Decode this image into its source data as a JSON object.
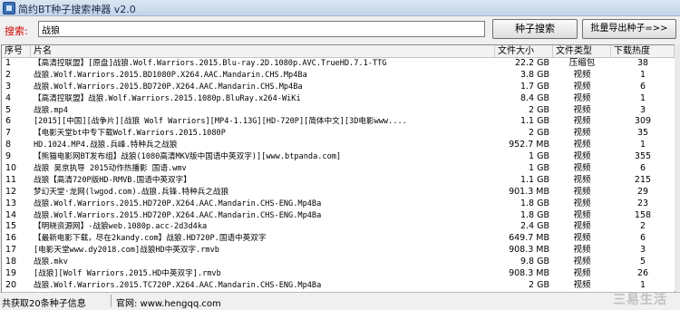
{
  "window": {
    "title": "简约BT种子搜索神器 v2.0"
  },
  "toolbar": {
    "search_label": "搜索:",
    "search_value": "战狼",
    "search_button": "种子搜索",
    "export_button": "批量导出种子=>>"
  },
  "grid": {
    "columns": [
      "序号",
      "片名",
      "文件大小",
      "文件类型",
      "下载热度"
    ],
    "rows": [
      {
        "idx": "1",
        "name": "【高清控联盟】[原盘]战狼.Wolf.Warriors.2015.Blu-ray.2D.1080p.AVC.TrueHD.7.1-TTG",
        "size": "22.2 GB",
        "type": "压缩包",
        "heat": "38"
      },
      {
        "idx": "2",
        "name": "战狼.Wolf.Warriors.2015.BD1080P.X264.AAC.Mandarin.CHS.Mp4Ba",
        "size": "3.8 GB",
        "type": "视频",
        "heat": "1"
      },
      {
        "idx": "3",
        "name": "战狼.Wolf.Warriors.2015.BD720P.X264.AAC.Mandarin.CHS.Mp4Ba",
        "size": "1.7 GB",
        "type": "视频",
        "heat": "6"
      },
      {
        "idx": "4",
        "name": "【高清控联盟】战狼.Wolf.Warriors.2015.1080p.BluRay.x264-WiKi",
        "size": "8.4 GB",
        "type": "视频",
        "heat": "1"
      },
      {
        "idx": "5",
        "name": "战狼.mp4",
        "size": "2 GB",
        "type": "视频",
        "heat": "3"
      },
      {
        "idx": "6",
        "name": "[2015][中国][战争片][战狼 Wolf Warriors][MP4-1.13G][HD-720P][简体中文][3D电影www....",
        "size": "1.1 GB",
        "type": "视频",
        "heat": "309"
      },
      {
        "idx": "7",
        "name": "【电影天堂bt中专下载Wolf.Warriors.2015.1080P",
        "size": "2 GB",
        "type": "视频",
        "heat": "35"
      },
      {
        "idx": "8",
        "name": "HD.1024.MP4.战狼.兵峰.特种兵之战狼",
        "size": "952.7 MB",
        "type": "视频",
        "heat": "1"
      },
      {
        "idx": "9",
        "name": "【熊猫电影网BT发布组】战狼(1080高清MKV版中国语中英双字)][www.btpanda.com]",
        "size": "1 GB",
        "type": "视频",
        "heat": "355"
      },
      {
        "idx": "10",
        "name": "战狼 吴京执导 2015动作热播影 国语.wmv",
        "size": "1 GB",
        "type": "视频",
        "heat": "6"
      },
      {
        "idx": "11",
        "name": "战狼【高清720P版HD-RMVB.国语中英双字】",
        "size": "1.1 GB",
        "type": "视频",
        "heat": "215"
      },
      {
        "idx": "12",
        "name": "梦幻天堂·龙网(lwgod.com).战狼.兵锋.特种兵之战狼",
        "size": "901.3 MB",
        "type": "视频",
        "heat": "29"
      },
      {
        "idx": "13",
        "name": "战狼.Wolf.Warriors.2015.HD720P.X264.AAC.Mandarin.CHS-ENG.Mp4Ba",
        "size": "1.8 GB",
        "type": "视频",
        "heat": "23"
      },
      {
        "idx": "14",
        "name": "战狼.Wolf.Warriors.2015.HD720P.X264.AAC.Mandarin.CHS-ENG.Mp4Ba",
        "size": "1.8 GB",
        "type": "视频",
        "heat": "158"
      },
      {
        "idx": "15",
        "name": "【明晓资源网】-战狼web.1080p.acc-2d3d4ka",
        "size": "2.4 GB",
        "type": "视频",
        "heat": "2"
      },
      {
        "idx": "16",
        "name": "【最新电影下载，尽在2kandy.com】战狼.HD720P.国语中英双字",
        "size": "649.7 MB",
        "type": "视频",
        "heat": "6"
      },
      {
        "idx": "17",
        "name": "[电影天堂www.dy2018.com]战狼HD中英双字.rmvb",
        "size": "908.3 MB",
        "type": "视频",
        "heat": "3"
      },
      {
        "idx": "18",
        "name": "战狼.mkv",
        "size": "9.8 GB",
        "type": "视频",
        "heat": "5"
      },
      {
        "idx": "19",
        "name": "[战狼][Wolf Warriors.2015.HD中英双字].rmvb",
        "size": "908.3 MB",
        "type": "视频",
        "heat": "26"
      },
      {
        "idx": "20",
        "name": "战狼.Wolf.Warriors.2015.TC720P.X264.AAC.Mandarin.CHS-ENG.Mp4Ba",
        "size": "2 GB",
        "type": "视频",
        "heat": "1"
      }
    ]
  },
  "status": {
    "count_text": "共获取20条种子信息",
    "site_text": "官网: www.hengqq.com"
  },
  "watermark": "三易生活"
}
